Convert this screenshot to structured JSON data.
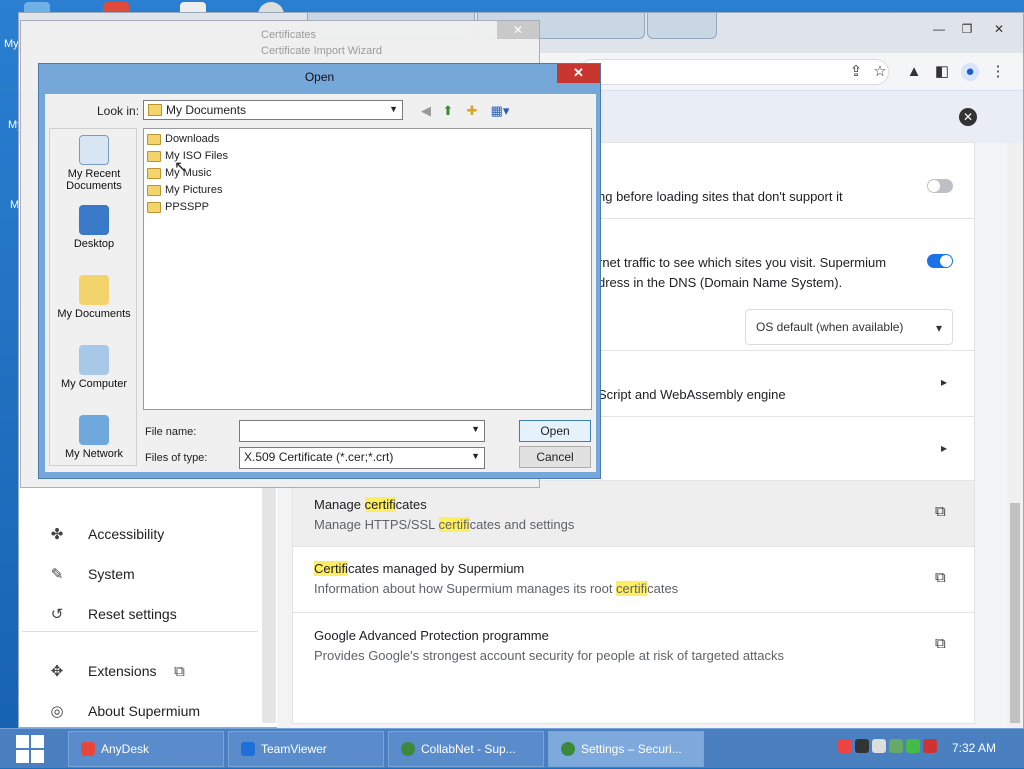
{
  "desktop": {
    "labels": [
      "My",
      "My",
      "My"
    ]
  },
  "browser": {
    "settings_rows": {
      "secure_desc": "ng before loading sites that don't support it",
      "dns_line1": "rnet traffic to see which sites you visit. Supermium",
      "dns_line2": "dress in the DNS (Domain Name System).",
      "dns_select": "OS default (when available)",
      "js_desc": "Script and WebAssembly engine",
      "manage_cert_title_pre": "Manage ",
      "manage_cert_title_hl": "certifi",
      "manage_cert_title_post": "cates",
      "manage_cert_desc_pre": "Manage HTTPS/SSL ",
      "manage_cert_desc_hl": "certifi",
      "manage_cert_desc_post": "cates and settings",
      "cert_managed_title_hl": "Certifi",
      "cert_managed_title_post": "cates managed by Supermium",
      "cert_managed_desc_pre": "Information about how Supermium manages its root ",
      "cert_managed_desc_hl": "certifi",
      "cert_managed_desc_post": "cates",
      "gap_title": "Google Advanced Protection programme",
      "gap_desc": "Provides Google's strongest account security for people at risk of targeted attacks"
    },
    "sidebar": {
      "items": [
        {
          "label": "Accessibility",
          "icon": "accessibility-icon"
        },
        {
          "label": "System",
          "icon": "wrench-icon"
        },
        {
          "label": "Reset settings",
          "icon": "reset-icon"
        },
        {
          "label": "Extensions",
          "icon": "puzzle-icon"
        },
        {
          "label": "About Supermium",
          "icon": "browser-logo-icon"
        }
      ]
    },
    "colors": {
      "toggle_on": "#1a73e8",
      "highlight": "#ffef60"
    }
  },
  "wizard": {
    "title_top": "Certificates",
    "title": "Certificate Import Wizard"
  },
  "dialog": {
    "title": "Open",
    "look_in_label": "Look in:",
    "look_in_value": "My Documents",
    "places": [
      {
        "label": "My Recent Documents"
      },
      {
        "label": "Desktop"
      },
      {
        "label": "My Documents"
      },
      {
        "label": "My Computer"
      },
      {
        "label": "My Network"
      }
    ],
    "files": [
      "Downloads",
      "My ISO Files",
      "My Music",
      "My Pictures",
      "PPSSPP"
    ],
    "file_name_label": "File name:",
    "file_name_value": "",
    "file_type_label": "Files of type:",
    "file_type_value": "X.509 Certificate (*.cer;*.crt)",
    "open_button": "Open",
    "cancel_button": "Cancel"
  },
  "taskbar": {
    "tasks": [
      {
        "label": "AnyDesk",
        "color": "#e8453c"
      },
      {
        "label": "TeamViewer",
        "color": "#1f6fd8"
      },
      {
        "label": "CollabNet - Sup...",
        "color": "#3a8a3a"
      },
      {
        "label": "Settings – Securi...",
        "color": "#3a8a3a"
      }
    ],
    "clock": "7:32 AM"
  }
}
